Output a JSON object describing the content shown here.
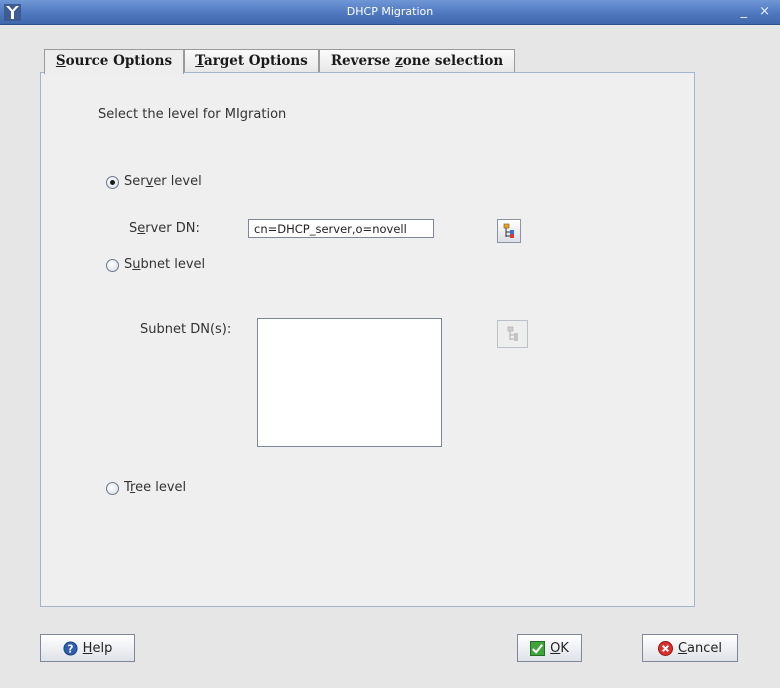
{
  "window": {
    "title": "DHCP Migration",
    "controls": "_ ×"
  },
  "tabs": [
    {
      "label": "Source Options",
      "mnemonic": "S",
      "rest": "ource Options",
      "active": true
    },
    {
      "label": "Target Options",
      "mnemonic": "T",
      "rest": "arget Options",
      "active": false
    },
    {
      "label": "Reverse zone selection",
      "pre": "Reverse ",
      "mnemonic": "z",
      "rest": "one selection",
      "active": false
    }
  ],
  "source": {
    "instruction": "Select the level for MIgration",
    "server_level": {
      "pre": "Ser",
      "mnemonic": "v",
      "post": "er level",
      "selected": true
    },
    "server_dn_label": {
      "pre": "S",
      "mnemonic": "e",
      "post": "rver DN:"
    },
    "server_dn_value": "cn=DHCP_server,o=novell",
    "subnet_level": {
      "pre": "S",
      "mnemonic": "u",
      "post": "bnet level",
      "selected": false
    },
    "subnet_dn_label": "Subnet DN(s):",
    "subnet_dn_values": [],
    "tree_level": {
      "pre": "T",
      "mnemonic": "r",
      "post": "ee level",
      "selected": false
    }
  },
  "buttons": {
    "help": {
      "mnemonic": "H",
      "post": "elp"
    },
    "ok": {
      "mnemonic": "O",
      "post": "K"
    },
    "cancel": {
      "mnemonic": "C",
      "post": "ancel"
    }
  },
  "icons": {
    "help": "help-circle-icon",
    "ok": "green-check-icon",
    "cancel": "red-x-icon",
    "browse": "tree-browse-icon"
  },
  "colors": {
    "titlebar": "#4f78bf",
    "panel_border": "#a4b4cc",
    "ok_green": "#3fa53a",
    "cancel_red": "#d9302b"
  }
}
